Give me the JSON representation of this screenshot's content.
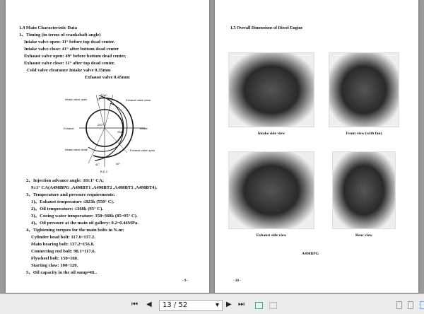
{
  "left_page": {
    "heading": "1.4 Main Characteristic Data",
    "lines": [
      "1、Timing (in terms of crankshaft angle)",
      "Intake valve open:    11° before top dead center.",
      "Intake valve close:   41° after bottom dead center",
      "Exhaust valve open:  49° before bottom dead center.",
      "Exhaust valve close: 11° after top dead center.",
      "Cold valve clearance     Intake valve 0.35mm",
      "Exhaust valve 0.45mm"
    ],
    "diagram": {
      "tdc": "T.D.C",
      "bdc": "B.D.C",
      "intake_open": "Intake valve open",
      "exhaust_close": "Exhaust valve close",
      "exhaust": "Exhaust",
      "intake": "Intake",
      "intake_close": "Intake valve close",
      "exhaust_open": "Exhaust valve open",
      "a11a": "11°",
      "a11b": "11°",
      "a240": "240°",
      "a232": "232°",
      "a41": "41°",
      "a49": "49°"
    },
    "lines2": [
      "2、Injection advance angle: 18±1° CA;",
      "9±1° CA(A498BPG ,A498BT1 ,A498BT2 ,A498BT3 ,A498BT4).",
      "3、Temperature and pressure requirements:",
      "1)、Exhaust temperature      ≤823k (550° C).",
      "2)、Oil temperature: ≤368k (95° C).",
      "3)、Cooing water temperature: 358~368k (85~95° C).",
      "4)、Oil pressure at the main oil gallery: 0.2~0.44MPa.",
      "4、Tightening torques for the main bolts in N-m:",
      "Cylinder head bolt: 117.6~137.2.",
      "Main bearing bolt: 137.2~156.8.",
      "Connecting rod bolt: 98.1~117.6.",
      "Flywheel bolt: 150~160.",
      "Starting claw: 100~120.",
      "5、Oil capacity in the oil sump≈6L."
    ],
    "page_num": "- 9 -"
  },
  "right_page": {
    "heading": "1.5 Overall Dimensions of Diesel Engine",
    "captions": [
      "Intake side view",
      "Front view (with fan)",
      "Exhaust side view",
      "Rear view"
    ],
    "model": "A498BPG",
    "page_num": "- 10 -"
  },
  "toolbar": {
    "page_value": "13 / 52",
    "first": "⏮",
    "prev": "◀",
    "next": "▶",
    "last": "⏭",
    "dropdown": "▾"
  }
}
